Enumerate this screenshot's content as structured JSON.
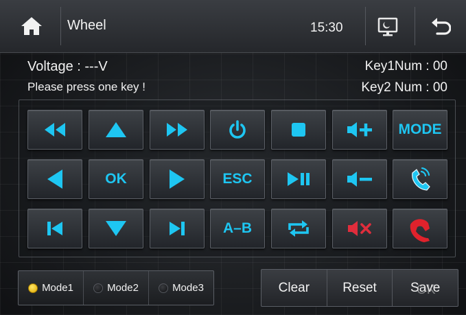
{
  "header": {
    "title": "Wheel",
    "time": "15:30"
  },
  "status": {
    "voltage": "Voltage : ---V",
    "prompt": "Please press one key !",
    "key1": "Key1Num : 00",
    "key2": "Key2 Num : 00"
  },
  "keys": {
    "mode": "MODE",
    "ok": "OK",
    "esc": "ESC",
    "ab": "A–B"
  },
  "modes": [
    {
      "label": "Mode1",
      "active": true
    },
    {
      "label": "Mode2",
      "active": false
    },
    {
      "label": "Mode3",
      "active": false
    }
  ],
  "actions": {
    "clear": "Clear",
    "reset": "Reset",
    "save": "Save",
    "save_overlay": "OK"
  },
  "colors": {
    "accent": "#1ec6f2",
    "mute": "#e02d3c",
    "hangup": "#e0222c",
    "led_on": "#f2c300"
  },
  "icons": [
    "home-icon",
    "screen-display-icon",
    "back-arrow-icon",
    "fast-rewind-icon",
    "up-arrow-icon",
    "fast-forward-icon",
    "power-icon",
    "stop-icon",
    "volume-up-icon",
    "left-arrow-icon",
    "right-arrow-icon",
    "play-pause-icon",
    "volume-down-icon",
    "call-answer-icon",
    "previous-track-icon",
    "down-arrow-icon",
    "next-track-icon",
    "repeat-icon",
    "mute-icon",
    "call-hangup-icon"
  ]
}
